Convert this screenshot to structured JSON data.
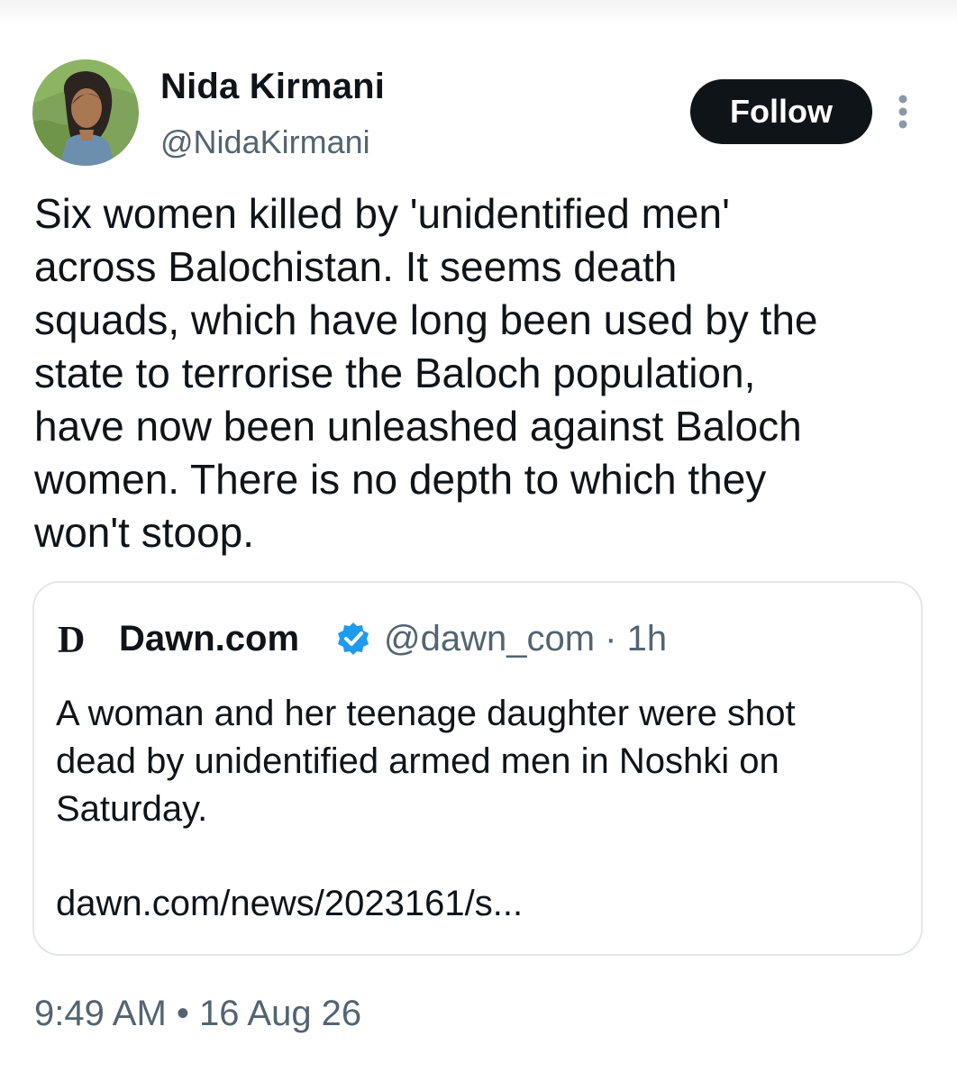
{
  "author": {
    "name": "Nida Kirmani",
    "handle": "@NidaKirmani",
    "follow_label": "Follow"
  },
  "tweet": {
    "text": "Six women killed by 'unidentified men'\nacross Balochistan. It seems death\nsquads, which have long been used by the\nstate to terrorise the Baloch population,\nhave now been unleashed against Baloch\nwomen. There is no depth to which they\nwon't stoop.",
    "timestamp": "9:49 AM • 16 Aug 26"
  },
  "quoted_tweet": {
    "logo_letter": "D",
    "name": "Dawn.com",
    "handle_time": "@dawn_com · 1h",
    "text": "A woman and her teenage daughter were shot\ndead by unidentified armed men in Noshki on\nSaturday.",
    "link": "dawn.com/news/2023161/s..."
  },
  "icons": {
    "avatar": "portrait-avatar",
    "more": "more-vertical-icon",
    "verified": "verified-badge-icon"
  },
  "colors": {
    "text": "#0f1419",
    "secondary": "#536471",
    "follow_bg": "#0f1419",
    "verified": "#1d9bf0",
    "border": "#e3e7ea"
  }
}
